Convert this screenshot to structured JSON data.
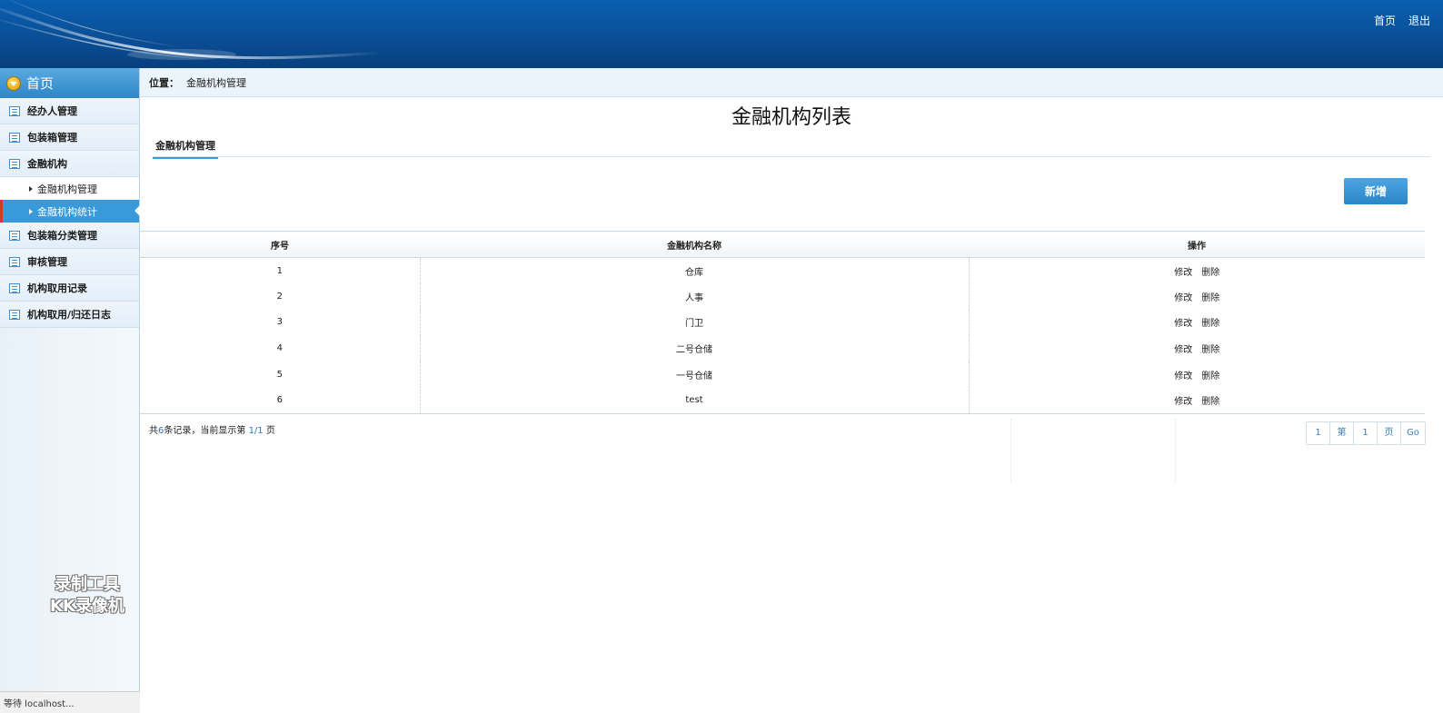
{
  "header": {
    "links": [
      "首页",
      "退出"
    ]
  },
  "sidebar": {
    "home_label": "首页",
    "items": [
      {
        "label": "经办人管理"
      },
      {
        "label": "包装箱管理"
      },
      {
        "label": "金融机构",
        "children": [
          {
            "label": "金融机构管理",
            "active": false
          },
          {
            "label": "金融机构统计",
            "active": true
          }
        ]
      },
      {
        "label": "包装箱分类管理"
      },
      {
        "label": "审核管理"
      },
      {
        "label": "机构取用记录"
      },
      {
        "label": "机构取用/归还日志"
      }
    ]
  },
  "watermark": {
    "line1": "录制工具",
    "line2": "KK录像机"
  },
  "statusbar": {
    "text": "等待 localhost..."
  },
  "breadcrumb": {
    "prefix": "位置：",
    "current": "金融机构管理"
  },
  "page": {
    "title": "金融机构列表",
    "tab_label": "金融机构管理",
    "add_button": "新增"
  },
  "table": {
    "headers": [
      "序号",
      "金融机构名称",
      "操作"
    ],
    "rows": [
      {
        "index": "1",
        "name": "仓库"
      },
      {
        "index": "2",
        "name": "人事"
      },
      {
        "index": "3",
        "name": "门卫"
      },
      {
        "index": "4",
        "name": "二号仓储"
      },
      {
        "index": "5",
        "name": "一号仓储"
      },
      {
        "index": "6",
        "name": "test"
      }
    ],
    "actions": [
      "修改",
      "删除"
    ]
  },
  "pagination": {
    "summary_prefix": "共",
    "total": "6",
    "summary_mid": "条记录，当前显示第",
    "pages": "1/1",
    "summary_suffix": "页",
    "controls": [
      "1",
      "第",
      "1",
      "页",
      "Go"
    ]
  },
  "colors": {
    "header_blue": "#0a4f97",
    "accent_blue": "#3a9ad9",
    "active_marker": "#d0392b"
  }
}
